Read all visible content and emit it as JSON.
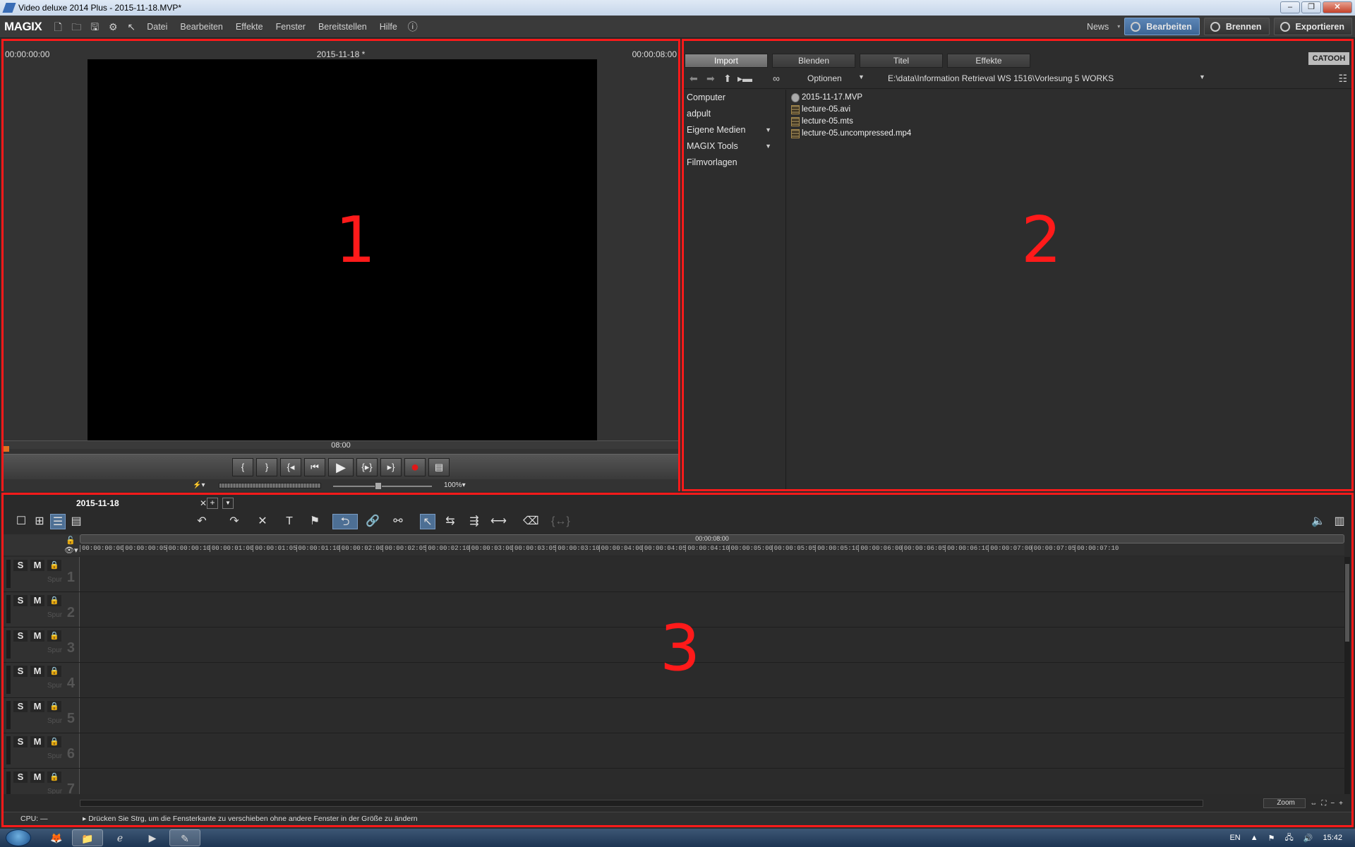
{
  "window": {
    "title": "Video deluxe 2014 Plus - 2015-11-18.MVP*",
    "controls": [
      "–",
      "❐",
      "✕"
    ]
  },
  "menubar": {
    "logo": "MAGIX",
    "icons": [
      "new-file-icon",
      "open-folder-icon",
      "save-icon",
      "settings-icon",
      "help-cursor-icon"
    ],
    "menus": [
      "Datei",
      "Bearbeiten",
      "Effekte",
      "Fenster",
      "Bereitstellen",
      "Hilfe"
    ],
    "news": "News",
    "modes": [
      {
        "label": "Bearbeiten",
        "active": true
      },
      {
        "label": "Brennen",
        "active": false
      },
      {
        "label": "Exportieren",
        "active": false
      }
    ]
  },
  "preview": {
    "tc_start": "00:00:00:00",
    "project_name": "2015-11-18 *",
    "tc_end": "00:00:08:00",
    "scrub_label": "08:00",
    "transport": [
      "{",
      "}",
      "{◂",
      "⏮",
      "▶",
      "{▸}",
      "▸}",
      "●",
      "▤"
    ],
    "zoom": "100%▾",
    "overlay_number": "1"
  },
  "mediapool": {
    "tabs": [
      {
        "label": "Import",
        "active": true
      },
      {
        "label": "Blenden",
        "active": false
      },
      {
        "label": "Titel",
        "active": false
      },
      {
        "label": "Effekte",
        "active": false
      }
    ],
    "brand": "CATOOH",
    "optionen": "Optionen",
    "path": "E:\\data\\Information Retrieval WS 1516\\Vorlesung 5 WORKS",
    "tree": [
      {
        "label": "Computer",
        "expand": false
      },
      {
        "label": "adpult",
        "expand": false
      },
      {
        "label": "Eigene Medien",
        "expand": true
      },
      {
        "label": "MAGIX Tools",
        "expand": true
      },
      {
        "label": "Filmvorlagen",
        "expand": false
      }
    ],
    "files": [
      {
        "name": "2015-11-17.MVP",
        "type": "project"
      },
      {
        "name": "lecture-05.avi",
        "type": "video"
      },
      {
        "name": "lecture-05.mts",
        "type": "video"
      },
      {
        "name": "lecture-05.uncompressed.mp4",
        "type": "video"
      }
    ],
    "overlay_number": "2"
  },
  "timeline": {
    "project_tab": "2015-11-18",
    "tab_close": "✕",
    "add_tab": "+",
    "total_time": "00:00:08:00",
    "ruler_ticks": [
      "00:00:00:00",
      "00:00:00:05",
      "00:00:00:10",
      "00:00:01:00",
      "00:00:01:05",
      "00:00:01:10",
      "00:00:02:00",
      "00:00:02:05",
      "00:00:02:10",
      "00:00:03:00",
      "00:00:03:05",
      "00:00:03:10",
      "00:00:04:00",
      "00:00:04:05",
      "00:00:04:10",
      "00:00:05:00",
      "00:00:05:05",
      "00:00:05:10",
      "00:00:06:00",
      "00:00:06:05",
      "00:00:06:10",
      "00:00:07:00",
      "00:00:07:05",
      "00:00:07:10"
    ],
    "tracks": [
      {
        "num": "1",
        "label": "Spur"
      },
      {
        "num": "2",
        "label": "Spur"
      },
      {
        "num": "3",
        "label": "Spur"
      },
      {
        "num": "4",
        "label": "Spur"
      },
      {
        "num": "5",
        "label": "Spur"
      },
      {
        "num": "6",
        "label": "Spur"
      },
      {
        "num": "7",
        "label": "Spur"
      }
    ],
    "solo": "S",
    "mute": "M",
    "zoom_label": "Zoom",
    "cpu": "CPU: —",
    "status_msg": "Drücken Sie Strg, um die Fensterkante zu verschieben ohne andere Fenster in der Größe zu ändern",
    "overlay_number": "3"
  },
  "taskbar": {
    "lang": "EN",
    "time": "15:42"
  }
}
